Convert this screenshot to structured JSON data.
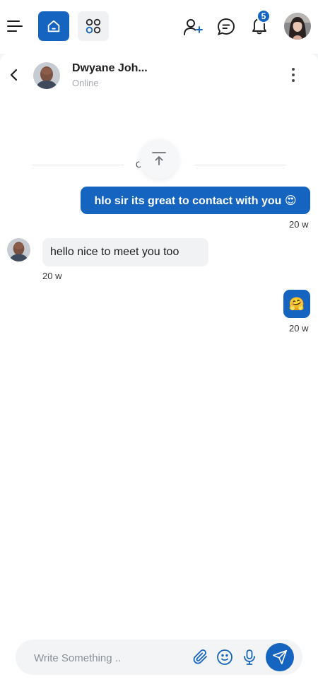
{
  "header": {
    "notification_count": "5",
    "icons": [
      "menu-icon",
      "home-icon",
      "apps-icon",
      "add-user-icon",
      "chat-icon",
      "bell-icon"
    ],
    "accent_color": "#1565c0"
  },
  "contact": {
    "name": "Dwyane Joh...",
    "status": "Online"
  },
  "conversation": {
    "date_divider": "O... 01",
    "messages": [
      {
        "direction": "out",
        "text": "hlo sir its great to contact with you 😍",
        "time": "20 w"
      },
      {
        "direction": "in",
        "text": "hello nice to meet you too",
        "time": "20 w"
      },
      {
        "direction": "out",
        "text": "🤗",
        "time": "20 w"
      }
    ]
  },
  "composer": {
    "placeholder": "Write Something ..",
    "value": ""
  }
}
